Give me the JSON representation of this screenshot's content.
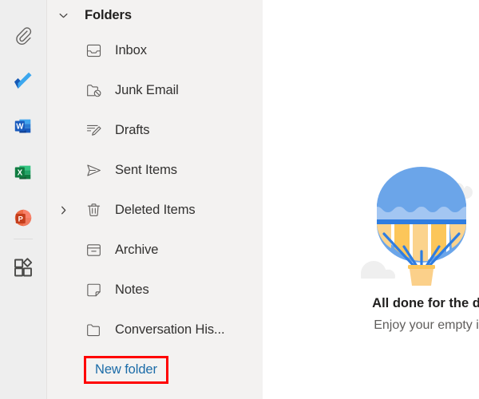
{
  "app_rail": {
    "items": [
      {
        "name": "attachments-icon",
        "label": "Attachments"
      },
      {
        "name": "to-do-icon",
        "label": "To Do"
      },
      {
        "name": "word-icon",
        "label": "Word"
      },
      {
        "name": "excel-icon",
        "label": "Excel"
      },
      {
        "name": "powerpoint-icon",
        "label": "PowerPoint"
      },
      {
        "name": "apps-icon",
        "label": "Apps"
      }
    ]
  },
  "folder_pane": {
    "header": {
      "title": "Folders",
      "twisty": "chevron-down-icon"
    },
    "items": [
      {
        "label": "Inbox",
        "icon": "inbox-icon",
        "twisty": ""
      },
      {
        "label": "Junk Email",
        "icon": "junk-email-icon",
        "twisty": ""
      },
      {
        "label": "Drafts",
        "icon": "drafts-icon",
        "twisty": ""
      },
      {
        "label": "Sent Items",
        "icon": "sent-items-icon",
        "twisty": ""
      },
      {
        "label": "Deleted Items",
        "icon": "trash-icon",
        "twisty": "chevron-right-icon"
      },
      {
        "label": "Archive",
        "icon": "archive-icon",
        "twisty": ""
      },
      {
        "label": "Notes",
        "icon": "notes-icon",
        "twisty": ""
      },
      {
        "label": "Conversation His...",
        "icon": "folder-icon",
        "twisty": ""
      }
    ],
    "new_folder_label": "New folder",
    "new_folder_link_color": "#1c6ca8",
    "highlight_color": "#ff0000"
  },
  "content_pane": {
    "empty_state": {
      "illustration": "hot-air-balloon-illustration",
      "title": "All done for the d",
      "subtitle": "Enjoy your empty i",
      "balloon_colors": {
        "canopy": "#6ba5e9",
        "canopy_light": "#a3c6f2",
        "band": "#2f7de1",
        "stripe": "#fbd38d",
        "stripe_alt": "#fcc65a",
        "basket": "#fbd08a",
        "cloud": "#f0f0f0"
      }
    }
  }
}
